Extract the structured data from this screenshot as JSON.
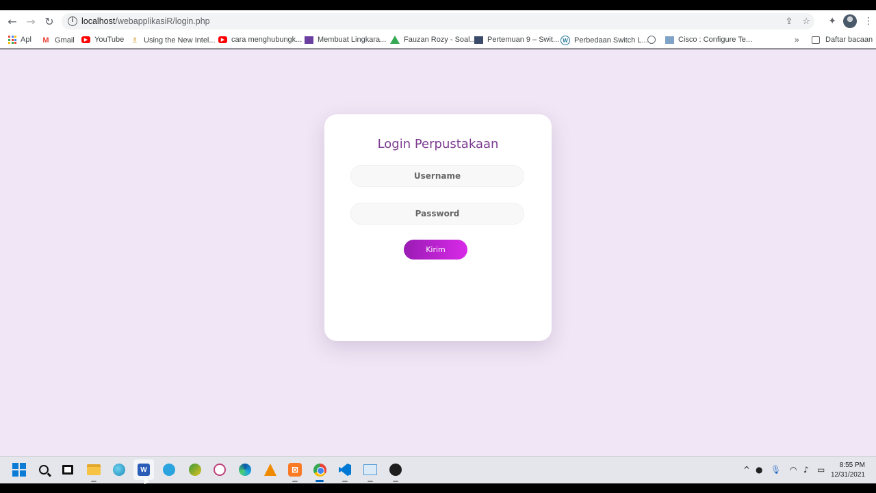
{
  "browser": {
    "url_host": "localhost",
    "url_path": "/webapplikasiR/login.php",
    "bookmarks": [
      {
        "label": "Apl",
        "icon": "apps-grid-icon"
      },
      {
        "label": "Gmail",
        "icon": "gmail-icon"
      },
      {
        "label": "YouTube",
        "icon": "youtube-icon"
      },
      {
        "label": "Using the New Intel...",
        "icon": "intel-icon"
      },
      {
        "label": "cara menghubungk...",
        "icon": "youtube-icon"
      },
      {
        "label": "Membuat Lingkara...",
        "icon": "bookmark-favicon-icon"
      },
      {
        "label": "Fauzan Rozy - Soal...",
        "icon": "google-drive-icon"
      },
      {
        "label": "Pertemuan 9 – Swit...",
        "icon": "bookmark-favicon-icon"
      },
      {
        "label": "Perbedaan Switch L...",
        "icon": "wordpress-icon"
      },
      {
        "label": "",
        "icon": "globe-icon"
      },
      {
        "label": "Cisco : Configure Te...",
        "icon": "bookmark-favicon-icon"
      }
    ],
    "more_label": "»",
    "reading_list_label": "Daftar bacaan"
  },
  "login": {
    "title": "Login Perpustakaan",
    "username_placeholder": "Username",
    "password_placeholder": "Password",
    "submit_label": "Kirim"
  },
  "taskbar": {
    "time": "8:55 PM",
    "date": "12/31/2021"
  },
  "colors": {
    "page_background": "#f0e6f5",
    "title_color": "#7b3a8e",
    "button_gradient_start": "#9a1bb4",
    "button_gradient_end": "#d92ae8"
  }
}
